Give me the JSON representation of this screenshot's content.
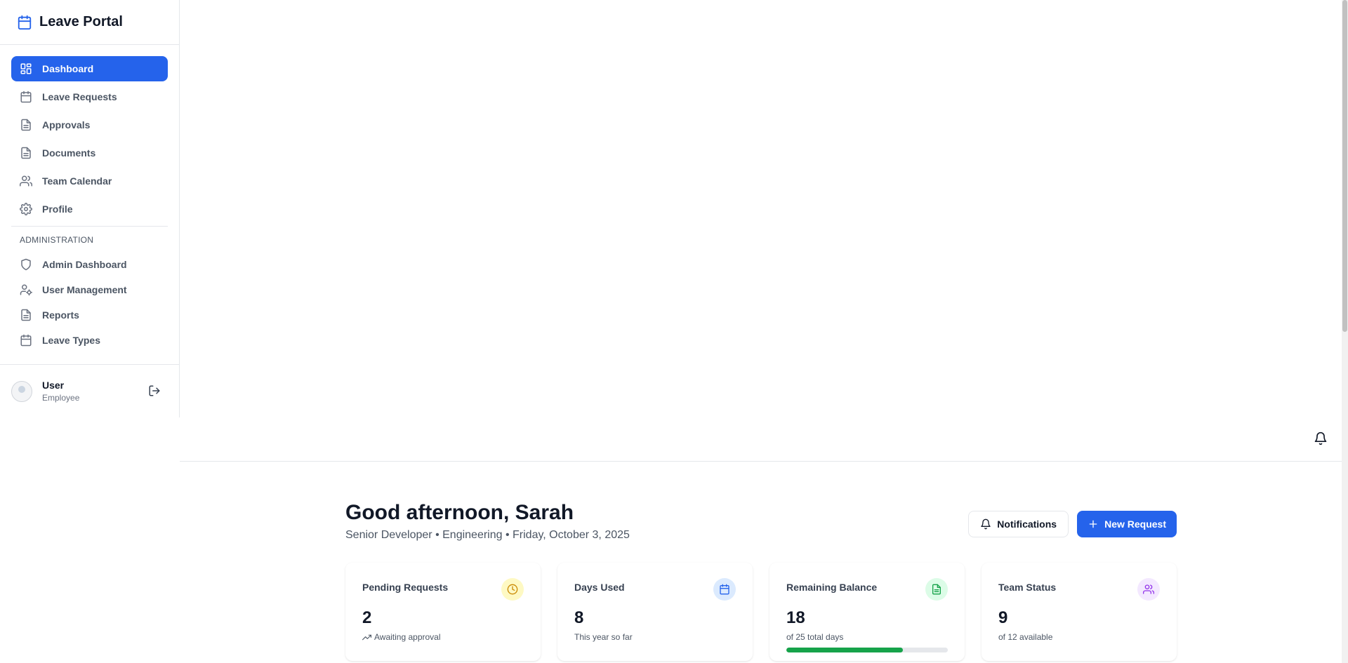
{
  "brand": {
    "title": "Leave Portal"
  },
  "nav": {
    "items": [
      {
        "label": "Dashboard",
        "icon": "dashboard-icon",
        "active": true
      },
      {
        "label": "Leave Requests",
        "icon": "calendar-icon"
      },
      {
        "label": "Approvals",
        "icon": "document-icon"
      },
      {
        "label": "Documents",
        "icon": "document-icon"
      },
      {
        "label": "Team Calendar",
        "icon": "users-icon"
      },
      {
        "label": "Profile",
        "icon": "gear-icon"
      }
    ],
    "admin_label": "ADMINISTRATION",
    "admin_items": [
      {
        "label": "Admin Dashboard",
        "icon": "shield-icon"
      },
      {
        "label": "User Management",
        "icon": "user-gear-icon"
      },
      {
        "label": "Reports",
        "icon": "document-icon"
      },
      {
        "label": "Leave Types",
        "icon": "calendar-icon"
      }
    ]
  },
  "user": {
    "name": "User",
    "role": "Employee"
  },
  "main": {
    "greeting": "Good afternoon, Sarah",
    "subline": "Senior Developer • Engineering • Friday, October 3, 2025",
    "notifications_label": "Notifications",
    "new_request_label": "New Request"
  },
  "cards": [
    {
      "title": "Pending Requests",
      "value": "2",
      "note": "Awaiting approval",
      "icon": "clock-icon",
      "icon_bg": "#fef9c3",
      "icon_color": "#ca8a04"
    },
    {
      "title": "Days Used",
      "value": "8",
      "note": "This year so far",
      "icon": "calendar-icon",
      "icon_bg": "#dbeafe",
      "icon_color": "#2563eb"
    },
    {
      "title": "Remaining Balance",
      "value": "18",
      "note": "of 25 total days",
      "icon": "document-icon",
      "icon_bg": "#dcfce7",
      "icon_color": "#16a34a",
      "progress": 0.72
    },
    {
      "title": "Team Status",
      "value": "9",
      "note": "of 12 available",
      "icon": "users-icon",
      "icon_bg": "#f3e8ff",
      "icon_color": "#9333ea"
    }
  ],
  "colors": {
    "accent": "#2563eb",
    "success": "#16a34a"
  }
}
